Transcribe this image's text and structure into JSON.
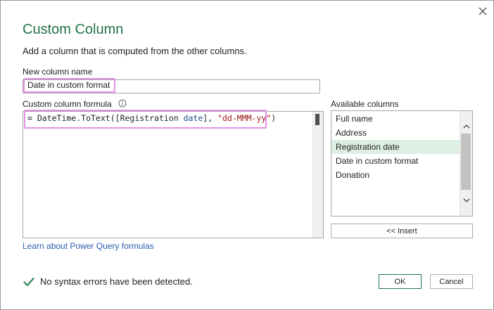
{
  "dialog": {
    "title": "Custom Column",
    "subtitle": "Add a column that is computed from the other columns.",
    "close_icon": "close-icon"
  },
  "new_column": {
    "label": "New column name",
    "value": "Date in custom format"
  },
  "formula": {
    "label": "Custom column formula",
    "info_icon": "info-icon",
    "tokens": {
      "prefix": "= DateTime.ToText(",
      "open_bracket": "[",
      "col_first": "Registration ",
      "col_second": "date",
      "close_bracket": "]",
      "separator": ", ",
      "string": "\"dd-MMM-yy\"",
      "close_paren": ")"
    }
  },
  "available": {
    "label": "Available columns",
    "items": [
      "Full name",
      "Address",
      "Registration date",
      "Date in custom format",
      "Donation"
    ],
    "selected": "Registration date",
    "insert_label": "<< Insert"
  },
  "learn_link": "Learn about Power Query formulas",
  "status": {
    "icon": "checkmark-icon",
    "text": "No syntax errors have been detected."
  },
  "buttons": {
    "ok": "OK",
    "cancel": "Cancel"
  },
  "colors": {
    "title": "#217346",
    "highlight": "#e58ee8",
    "selected": "#dcefe2",
    "link": "#2a5db0",
    "check": "#2e8b57"
  }
}
